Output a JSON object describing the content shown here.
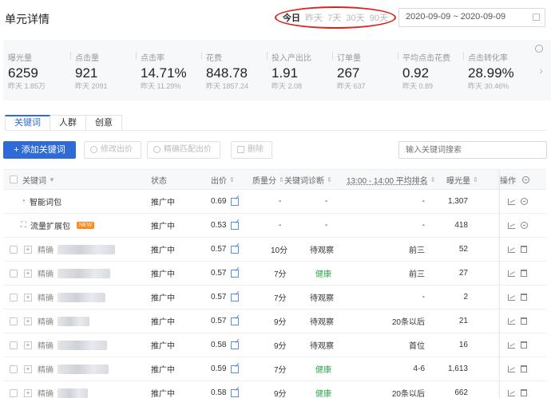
{
  "page": {
    "title": "单元详情"
  },
  "date_range": {
    "tabs": [
      "今日",
      "昨天",
      "7天",
      "30天",
      "90天"
    ],
    "active": "今日",
    "value": "2020-09-09 ~ 2020-09-09"
  },
  "metrics": [
    {
      "label": "曝光量",
      "value": "6259",
      "sub": "昨天 1.85万"
    },
    {
      "label": "点击量",
      "value": "921",
      "sub": "昨天 2091"
    },
    {
      "label": "点击率",
      "value": "14.71%",
      "sub": "昨天 11.29%"
    },
    {
      "label": "花费",
      "value": "848.78",
      "sub": "昨天 1857.24"
    },
    {
      "label": "投入产出比",
      "value": "1.91",
      "sub": "昨天 2.08"
    },
    {
      "label": "订单量",
      "value": "267",
      "sub": "昨天 637"
    },
    {
      "label": "平均点击花费",
      "value": "0.92",
      "sub": "昨天 0.89"
    },
    {
      "label": "点击转化率",
      "value": "28.99%",
      "sub": "昨天 30.46%"
    }
  ],
  "sub_tabs": [
    "关键词",
    "人群",
    "创意"
  ],
  "toolbar": {
    "add_label": "+ 添加关键词",
    "modify_bid_label": "修改出价",
    "exact_match_bid_label": "精确匹配出价",
    "delete_label": "删除",
    "search_placeholder": "输入关键词搜索"
  },
  "table": {
    "headers": {
      "keyword": "关键词",
      "status": "状态",
      "bid": "出价",
      "quality": "质量分",
      "diagnosis": "关键词诊断",
      "rank": "13:00 - 14:00 平均排名",
      "exposure": "曝光量",
      "ops": "操作"
    },
    "rows": [
      {
        "type": "smart",
        "keyword": "智能词包",
        "status": "推广中",
        "bid": "0.69",
        "quality": "-",
        "diagnosis": "-",
        "rank": "-",
        "exposure": "1,307"
      },
      {
        "type": "traffic",
        "keyword": "流量扩展包",
        "badge": "NEW",
        "status": "推广中",
        "bid": "0.53",
        "quality": "-",
        "diagnosis": "-",
        "rank": "-",
        "exposure": "418"
      },
      {
        "type": "kw",
        "keyword": "精确",
        "status": "推广中",
        "bid": "0.57",
        "quality": "10分",
        "diagnosis": "待观察",
        "rank": "前三",
        "exposure": "52"
      },
      {
        "type": "kw",
        "keyword": "精确",
        "status": "推广中",
        "bid": "0.57",
        "quality": "7分",
        "diagnosis": "健康",
        "rank": "前三",
        "exposure": "27"
      },
      {
        "type": "kw",
        "keyword": "精确",
        "status": "推广中",
        "bid": "0.57",
        "quality": "7分",
        "diagnosis": "待观察",
        "rank": "-",
        "exposure": "2"
      },
      {
        "type": "kw",
        "keyword": "精确",
        "status": "推广中",
        "bid": "0.57",
        "quality": "9分",
        "diagnosis": "待观察",
        "rank": "20条以后",
        "exposure": "21"
      },
      {
        "type": "kw",
        "keyword": "精确",
        "status": "推广中",
        "bid": "0.58",
        "quality": "9分",
        "diagnosis": "待观察",
        "rank": "首位",
        "exposure": "16"
      },
      {
        "type": "kw",
        "keyword": "精确",
        "status": "推广中",
        "bid": "0.59",
        "quality": "7分",
        "diagnosis": "健康",
        "rank": "4-6",
        "exposure": "1,613"
      },
      {
        "type": "kw",
        "keyword": "精确",
        "status": "推广中",
        "bid": "0.58",
        "quality": "9分",
        "diagnosis": "健康",
        "rank": "20条以后",
        "exposure": "662"
      }
    ]
  }
}
